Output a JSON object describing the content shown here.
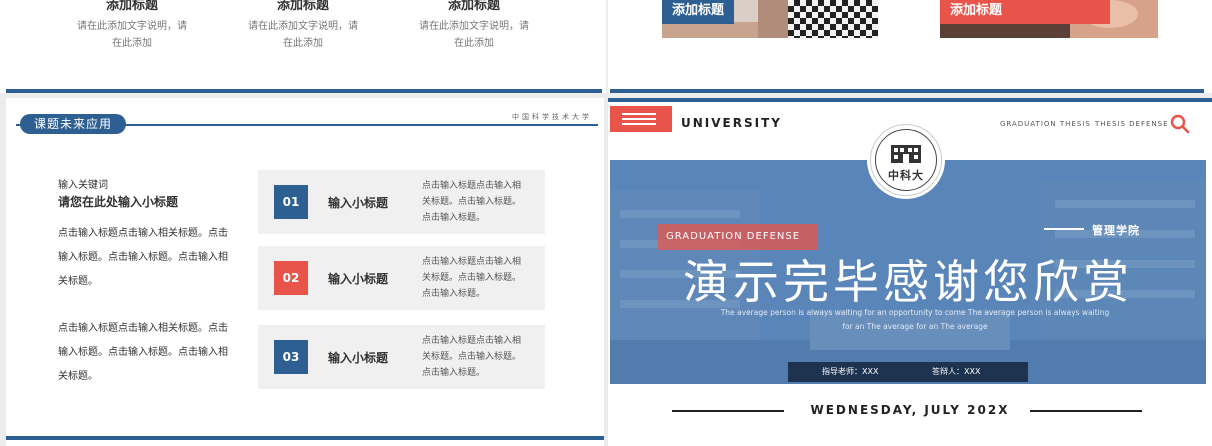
{
  "top_left": {
    "columns": [
      {
        "title": "添加标题",
        "desc1": "请在此添加文字说明，请",
        "desc2": "在此添加"
      },
      {
        "title": "添加标题",
        "desc1": "请在此添加文字说明，请",
        "desc2": "在此添加"
      },
      {
        "title": "添加标题",
        "desc1": "请在此添加文字说明，请",
        "desc2": "在此添加"
      }
    ]
  },
  "top_right": {
    "labels": [
      "添加标题",
      "添加标题"
    ]
  },
  "bottom_left": {
    "section_title": "课题未来应用",
    "university": "中国科学技术大学",
    "keyword_label": "输入关键词",
    "subtitle": "请您在此处输入小标题",
    "para1": [
      "点击输入标题点击输入相关标题。点击",
      "输入标题。点击输入标题。点击输入相",
      "关标题。"
    ],
    "para2": [
      "点击输入标题点击输入相关标题。点击",
      "输入标题。点击输入标题。点击输入相",
      "关标题。"
    ],
    "cards": [
      {
        "num": "01",
        "title": "输入小标题",
        "desc": [
          "点击输入标题点击输入相",
          "关标题。点击输入标题。",
          "点击输入标题。"
        ],
        "color": "#2e5f92"
      },
      {
        "num": "02",
        "title": "输入小标题",
        "desc": [
          "点击输入标题点击输入相",
          "关标题。点击输入标题。",
          "点击输入标题。"
        ],
        "color": "#e8544a"
      },
      {
        "num": "03",
        "title": "输入小标题",
        "desc": [
          "点击输入标题点击输入相",
          "关标题。点击输入标题。",
          "点击输入标题。"
        ],
        "color": "#2e5f92"
      }
    ]
  },
  "bottom_right": {
    "brand": "UNIVERSITY",
    "nav": [
      "GRADUATION THESIS",
      "THESIS DEFENSE"
    ],
    "logo_text": "中科大",
    "tag": "GRADUATION DEFENSE",
    "school": "管理学院",
    "main_title": "演示完毕感谢您欣赏",
    "english_line1": "The average person is always waiting for an opportunity to come The average person is always waiting",
    "english_line2": "for an The average for an The average",
    "advisor": "指导老师：XXX",
    "presenter": "答辩人：XXX",
    "date": "WEDNESDAY,  JULY 202X"
  },
  "colors": {
    "primary": "#2e5f92",
    "accent": "#e8544a",
    "dark": "#1e3350"
  }
}
